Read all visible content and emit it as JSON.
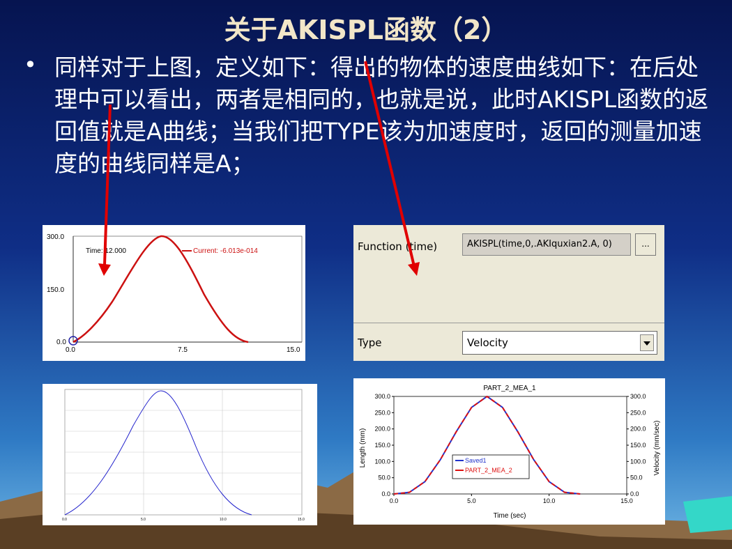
{
  "slide": {
    "title": "关于AKISPL函数（2）",
    "bullet": "同样对于上图，定义如下：得出的物体的速度曲线如下：在后处理中可以看出，两者是相同的，也就是说，此时AKISPL函数的返回值就是A曲线；当我们把TYPE该为加速度时，返回的测量加速度的曲线同样是A；"
  },
  "colors": {
    "sky_top": "#0a1a5c",
    "sky_bottom": "#2a6fb8",
    "title": "#f2e6c8",
    "arrow": "#e00000",
    "curve_red": "#cc1111",
    "curve_blue": "#2222cc"
  },
  "spline_plot": {
    "y_ticks": [
      "300.0",
      "150.0",
      "0.0"
    ],
    "x_ticks": [
      "0.0",
      "7.5",
      "15.0"
    ],
    "time_label": "Time: 12.000",
    "current_label": "Current: -6.013e-014"
  },
  "function_dialog": {
    "function_label": "Function (time)",
    "function_value": "AKISPL(time,0,.AKIquxian2.A, 0)",
    "browse_button": "...",
    "type_label": "Type",
    "type_value": "Velocity",
    "dropdown_icon": "triangle-down-icon"
  },
  "small_plot": {
    "x_ticks": [
      "0.0",
      "5.0",
      "10.0",
      "15.0"
    ]
  },
  "chart_data": {
    "type": "line",
    "title": "PART_2_MEA_1",
    "xlabel": "Time (sec)",
    "ylabel": "Length (mm)",
    "ylabel_right": "Velocity (mm/sec)",
    "xlim": [
      0,
      15
    ],
    "ylim": [
      0,
      300
    ],
    "x_ticks": [
      "0.0",
      "5.0",
      "10.0",
      "15.0"
    ],
    "y_ticks": [
      "0.0",
      "50.0",
      "100.0",
      "150.0",
      "200.0",
      "250.0",
      "300.0"
    ],
    "x": [
      0,
      1,
      2,
      3,
      4,
      5,
      6,
      7,
      8,
      9,
      10,
      11,
      12
    ],
    "series": [
      {
        "name": "Saved1",
        "values": [
          0,
          5,
          38,
          106,
          190,
          266,
          300,
          266,
          190,
          106,
          38,
          5,
          0
        ]
      },
      {
        "name": "PART_2_MEA_2",
        "values": [
          0,
          5,
          38,
          106,
          190,
          266,
          300,
          266,
          190,
          106,
          38,
          5,
          0
        ]
      }
    ],
    "legend": "center"
  }
}
